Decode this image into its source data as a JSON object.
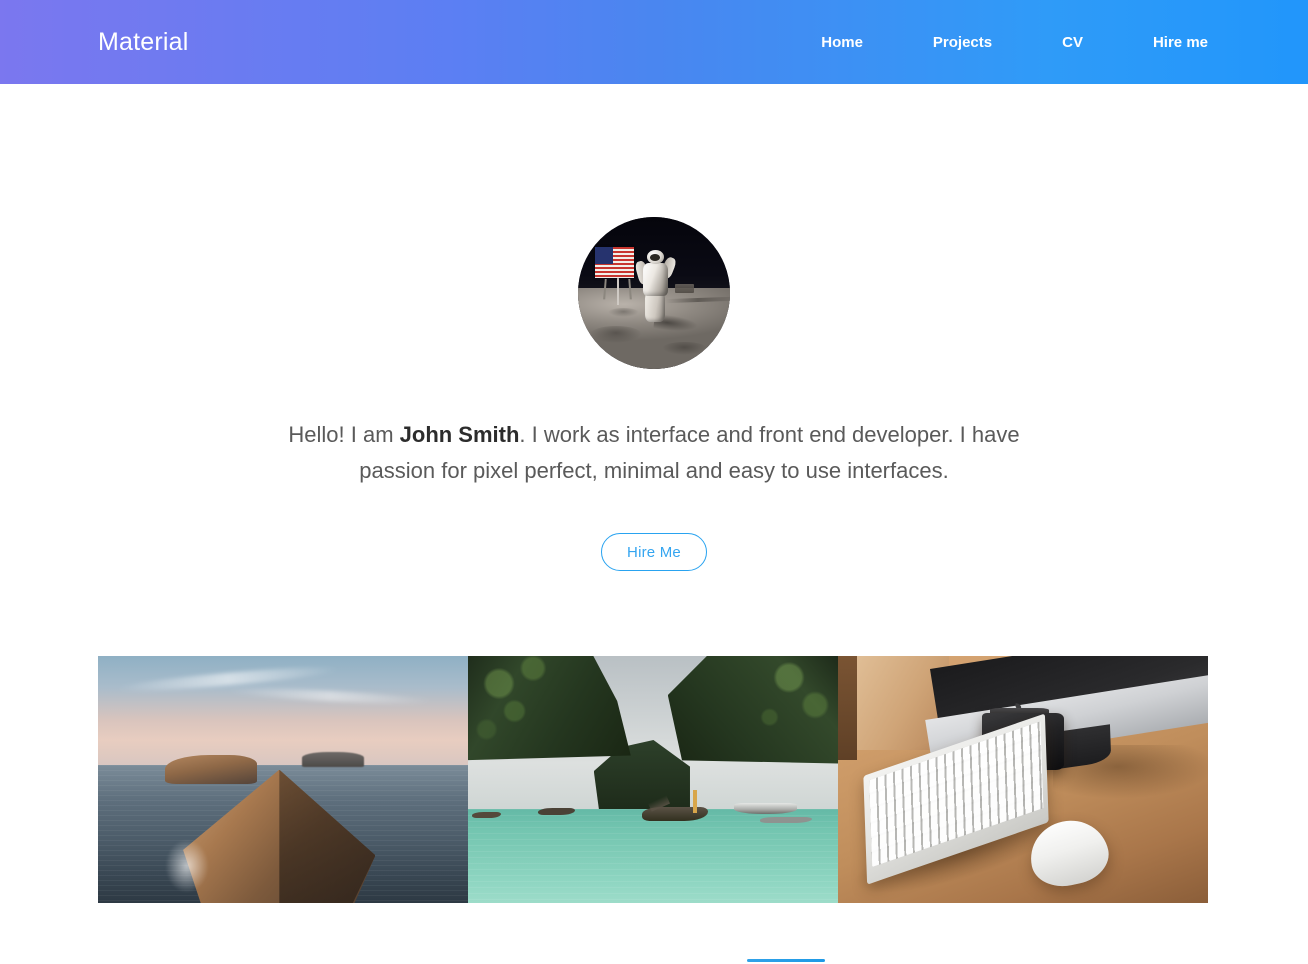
{
  "header": {
    "brand": "Material",
    "gradient_start": "#7b77ef",
    "gradient_end": "#2196fb",
    "nav": [
      {
        "label": "Home"
      },
      {
        "label": "Projects"
      },
      {
        "label": "CV"
      },
      {
        "label": "Hire me"
      }
    ]
  },
  "hero": {
    "avatar_alt": "astronaut-on-the-moon-photo",
    "intro_before_name": "Hello! I am ",
    "name": "John Smith",
    "intro_after_name": ". I work as interface and front end developer. I have passion for pixel perfect, minimal and easy to use interfaces.",
    "cta_label": "Hire Me",
    "cta_color": "#34a5f0"
  },
  "gallery": {
    "items": [
      {
        "alt": "sea-cliffs-at-sunset-photo"
      },
      {
        "alt": "tropical-lagoon-with-longtail-boats-photo"
      },
      {
        "alt": "desk-with-imac-keyboard-camera-and-mouse-photo"
      }
    ]
  },
  "section_divider": {
    "color": "#1e9ae6"
  }
}
